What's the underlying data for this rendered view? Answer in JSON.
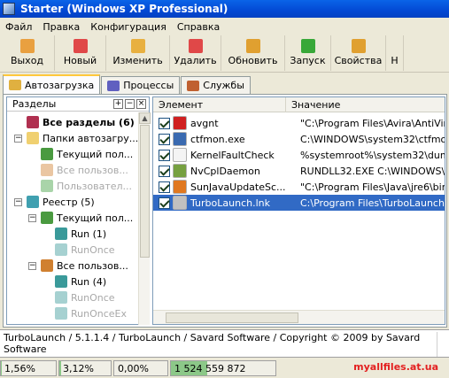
{
  "window": {
    "title": "Starter (Windows XP Professional)"
  },
  "menu": [
    "Файл",
    "Правка",
    "Конфигурация",
    "Справка"
  ],
  "toolbar": [
    {
      "label": "Выход",
      "icon": "exit-icon",
      "color": "#e9a040"
    },
    {
      "label": "Новый",
      "icon": "new-icon",
      "color": "#e04848"
    },
    {
      "label": "Изменить",
      "icon": "edit-icon",
      "color": "#e8b040"
    },
    {
      "label": "Удалить",
      "icon": "delete-icon",
      "color": "#e04848"
    },
    {
      "label": "Обновить",
      "icon": "refresh-icon",
      "color": "#e0a030"
    },
    {
      "label": "Запуск",
      "icon": "run-icon",
      "color": "#38a838"
    },
    {
      "label": "Свойства",
      "icon": "properties-icon",
      "color": "#e0a030"
    },
    {
      "label": "Н",
      "icon": "more-icon",
      "color": "#ece9d8"
    }
  ],
  "tabs": [
    {
      "label": "Автозагрузка",
      "icon": "autostart-icon",
      "active": true
    },
    {
      "label": "Процессы",
      "icon": "processes-icon",
      "active": false
    },
    {
      "label": "Службы",
      "icon": "services-icon",
      "active": false
    }
  ],
  "left": {
    "header": "Разделы",
    "header_buttons": [
      "+",
      "−",
      "×"
    ],
    "tree": [
      {
        "label": "Все разделы (6)",
        "bold": true,
        "dim": false,
        "icon": "sections-icon"
      },
      {
        "label": "Папки автозагру...",
        "bold": false,
        "dim": false,
        "icon": "folder-icon",
        "expander": "−"
      },
      {
        "label": "Текущий пол...",
        "bold": false,
        "dim": false,
        "icon": "user-icon"
      },
      {
        "label": "Все пользов...",
        "bold": false,
        "dim": true,
        "icon": "users-icon"
      },
      {
        "label": "Пользовател...",
        "bold": false,
        "dim": true,
        "icon": "user-add-icon"
      },
      {
        "label": "Реестр (5)",
        "bold": false,
        "dim": false,
        "icon": "registry-icon",
        "expander": "−"
      },
      {
        "label": "Текущий пол...",
        "bold": false,
        "dim": false,
        "icon": "user-icon",
        "expander": "−"
      },
      {
        "label": "Run (1)",
        "bold": false,
        "dim": false,
        "icon": "reg-key-icon"
      },
      {
        "label": "RunOnce",
        "bold": false,
        "dim": true,
        "icon": "reg-key-icon"
      },
      {
        "label": "Все пользов...",
        "bold": false,
        "dim": false,
        "icon": "users-icon",
        "expander": "−"
      },
      {
        "label": "Run (4)",
        "bold": false,
        "dim": false,
        "icon": "reg-key-icon"
      },
      {
        "label": "RunOnce",
        "bold": false,
        "dim": true,
        "icon": "reg-key-icon"
      },
      {
        "label": "RunOnceEx",
        "bold": false,
        "dim": true,
        "icon": "reg-key-icon"
      }
    ]
  },
  "right": {
    "columns": [
      "Элемент",
      "Значение"
    ],
    "rows": [
      {
        "name": "avgnt",
        "value": "\"C:\\Program Files\\Avira\\AntiVir Des",
        "icon": "avira-icon",
        "color": "#d02020",
        "selected": false
      },
      {
        "name": "ctfmon.exe",
        "value": "C:\\WINDOWS\\system32\\ctfmon.exe",
        "icon": "ctfmon-icon",
        "color": "#3a6ab0",
        "selected": false
      },
      {
        "name": "KernelFaultCheck",
        "value": "%systemroot%\\system32\\dumprep 0",
        "icon": "blank-icon",
        "color": "#f4f4f4",
        "selected": false
      },
      {
        "name": "NvCplDaemon",
        "value": "RUNDLL32.EXE C:\\WINDOWS\\sys",
        "icon": "nvidia-icon",
        "color": "#76a040",
        "selected": false
      },
      {
        "name": "SunJavaUpdateSc...",
        "value": "\"C:\\Program Files\\Java\\jre6\\bin\\jus",
        "icon": "java-icon",
        "color": "#e07820",
        "selected": false
      },
      {
        "name": "TurboLaunch.lnk",
        "value": "C:\\Program Files\\TurboLaunch\\Tur",
        "icon": "rocket-icon",
        "color": "#c0c0c0",
        "selected": true
      }
    ]
  },
  "info": "TurboLaunch / 5.1.1.4 / TurboLaunch / Savard Software / Copyright © 2009 by Savard Software",
  "status": [
    {
      "text": "1,56%",
      "fill": 0.0156
    },
    {
      "text": "3,12%",
      "fill": 0.0312
    },
    {
      "text": "0,00%",
      "fill": 0
    },
    {
      "text": "1 524 559 872",
      "fill": 0.35
    }
  ],
  "watermark": "myallfiles.at.ua"
}
